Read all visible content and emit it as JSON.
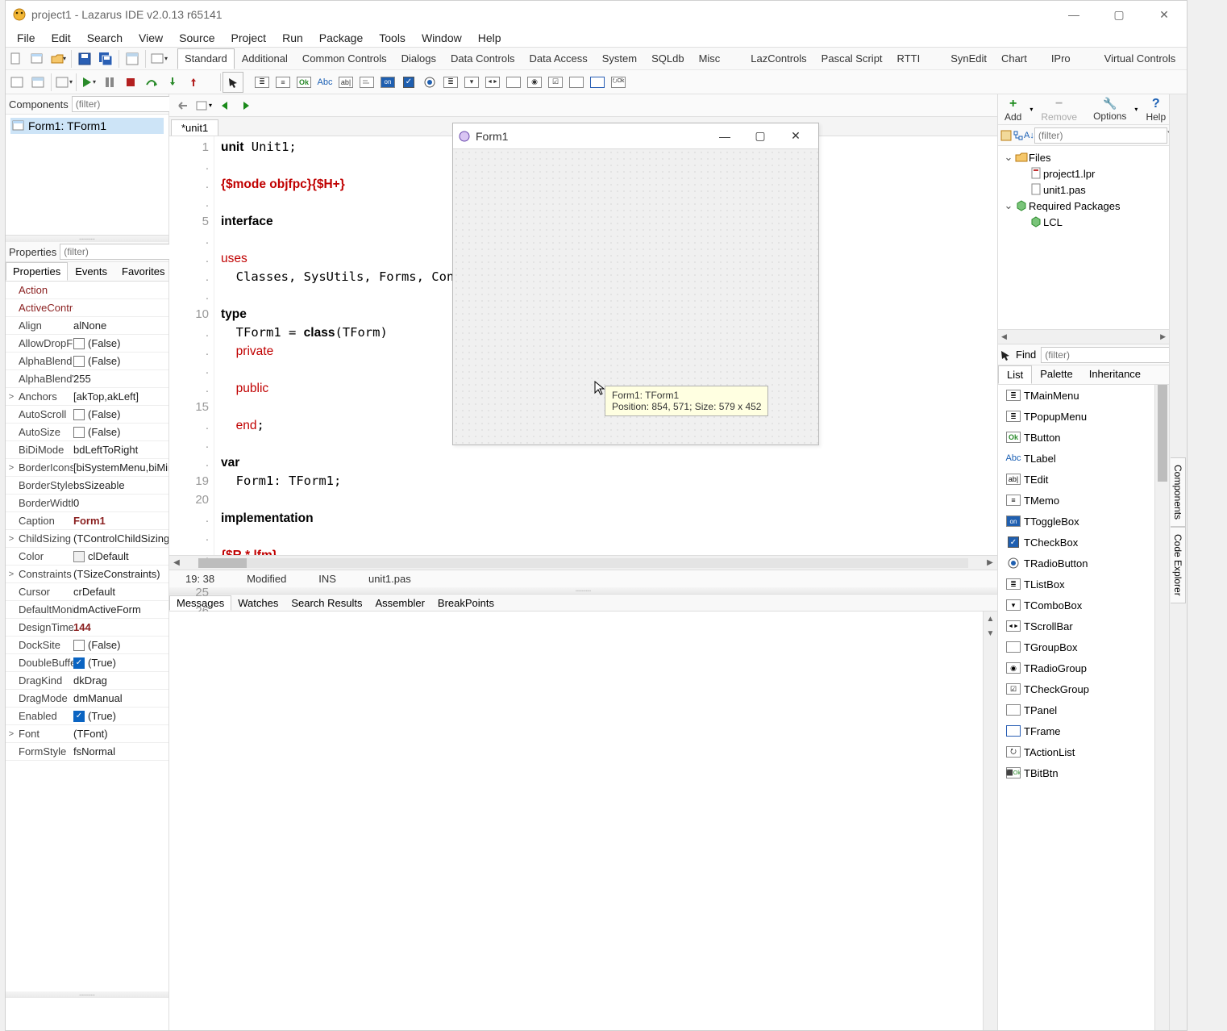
{
  "window": {
    "title": "project1 - Lazarus IDE v2.0.13 r65141"
  },
  "menu": [
    "File",
    "Edit",
    "Search",
    "View",
    "Source",
    "Project",
    "Run",
    "Package",
    "Tools",
    "Window",
    "Help"
  ],
  "palette_tabs": [
    "Standard",
    "Additional",
    "Common Controls",
    "Dialogs",
    "Data Controls",
    "Data Access",
    "System",
    "SQLdb",
    "Misc",
    "LazControls",
    "Pascal Script",
    "RTTI",
    "SynEdit",
    "Chart",
    "IPro",
    "Virtual Controls"
  ],
  "palette_tabs_active": "Standard",
  "components_panel": {
    "label": "Components",
    "filter_placeholder": "(filter)",
    "tree_item": "Form1: TForm1"
  },
  "properties_panel": {
    "label": "Properties",
    "filter_placeholder": "(filter)",
    "tabs": [
      "Properties",
      "Events",
      "Favorites"
    ],
    "active_tab": "Properties",
    "rows": [
      {
        "exp": "",
        "k": "Action",
        "v": "",
        "klink": true
      },
      {
        "exp": "",
        "k": "ActiveControl",
        "v": "",
        "klink": true
      },
      {
        "exp": "",
        "k": "Align",
        "v": "alNone"
      },
      {
        "exp": "",
        "k": "AllowDropFiles",
        "v": "(False)",
        "cb": false
      },
      {
        "exp": "",
        "k": "AlphaBlend",
        "v": "(False)",
        "cb": false
      },
      {
        "exp": "",
        "k": "AlphaBlendValue",
        "v": "255"
      },
      {
        "exp": ">",
        "k": "Anchors",
        "v": "[akTop,akLeft]"
      },
      {
        "exp": "",
        "k": "AutoScroll",
        "v": "(False)",
        "cb": false
      },
      {
        "exp": "",
        "k": "AutoSize",
        "v": "(False)",
        "cb": false
      },
      {
        "exp": "",
        "k": "BiDiMode",
        "v": "bdLeftToRight"
      },
      {
        "exp": ">",
        "k": "BorderIcons",
        "v": "[biSystemMenu,biMinimize,biMaximize]"
      },
      {
        "exp": "",
        "k": "BorderStyle",
        "v": "bsSizeable"
      },
      {
        "exp": "",
        "k": "BorderWidth",
        "v": "0"
      },
      {
        "exp": "",
        "k": "Caption",
        "v": "Form1",
        "vlink": true
      },
      {
        "exp": ">",
        "k": "ChildSizing",
        "v": "(TControlChildSizing)"
      },
      {
        "exp": "",
        "k": "Color",
        "v": "clDefault",
        "swatch": true
      },
      {
        "exp": ">",
        "k": "Constraints",
        "v": "(TSizeConstraints)"
      },
      {
        "exp": "",
        "k": "Cursor",
        "v": "crDefault"
      },
      {
        "exp": "",
        "k": "DefaultMonitor",
        "v": "dmActiveForm"
      },
      {
        "exp": "",
        "k": "DesignTimePPI",
        "v": "144",
        "vlink": true
      },
      {
        "exp": "",
        "k": "DockSite",
        "v": "(False)",
        "cb": false
      },
      {
        "exp": "",
        "k": "DoubleBuffered",
        "v": "(True)",
        "cb": true
      },
      {
        "exp": "",
        "k": "DragKind",
        "v": "dkDrag"
      },
      {
        "exp": "",
        "k": "DragMode",
        "v": "dmManual"
      },
      {
        "exp": "",
        "k": "Enabled",
        "v": "(True)",
        "cb": true
      },
      {
        "exp": ">",
        "k": "Font",
        "v": "(TFont)"
      },
      {
        "exp": "",
        "k": "FormStyle",
        "v": "fsNormal"
      }
    ]
  },
  "editor": {
    "tab": "*unit1",
    "gutter": [
      "1",
      ".",
      ".",
      ".",
      "5",
      ".",
      ".",
      ".",
      ".",
      "10",
      ".",
      ".",
      ".",
      ".",
      "15",
      ".",
      ".",
      ".",
      "19",
      "20",
      ".",
      ".",
      ".",
      ".",
      "25",
      "26"
    ],
    "status": {
      "pos": "19:  38",
      "state": "Modified",
      "mode": "INS",
      "file": "unit1.pas"
    }
  },
  "messages_tabs": [
    "Messages",
    "Watches",
    "Search Results",
    "Assembler",
    "BreakPoints"
  ],
  "right_panel": {
    "tools": {
      "add": "Add",
      "remove": "Remove",
      "options": "Options",
      "help": "Help"
    },
    "filter_placeholder": "(filter)",
    "tree": [
      {
        "exp": "v",
        "icon": "folder",
        "label": "Files",
        "indent": 0
      },
      {
        "exp": "",
        "icon": "file-lpr",
        "label": "project1.lpr",
        "indent": 1
      },
      {
        "exp": "",
        "icon": "file-pas",
        "label": "unit1.pas",
        "indent": 1
      },
      {
        "exp": "v",
        "icon": "package",
        "label": "Required Packages",
        "indent": 0
      },
      {
        "exp": "",
        "icon": "package",
        "label": "LCL",
        "indent": 1
      }
    ],
    "find_label": "Find",
    "find_placeholder": "(filter)",
    "palette_subtabs": [
      "List",
      "Palette",
      "Inheritance"
    ],
    "palette_list": [
      {
        "icon": "menu",
        "name": "TMainMenu"
      },
      {
        "icon": "menu",
        "name": "TPopupMenu"
      },
      {
        "icon": "button",
        "name": "TButton"
      },
      {
        "icon": "label",
        "name": "TLabel"
      },
      {
        "icon": "edit",
        "name": "TEdit"
      },
      {
        "icon": "memo",
        "name": "TMemo"
      },
      {
        "icon": "toggle",
        "name": "TToggleBox"
      },
      {
        "icon": "check",
        "name": "TCheckBox"
      },
      {
        "icon": "radio",
        "name": "TRadioButton"
      },
      {
        "icon": "listbox",
        "name": "TListBox"
      },
      {
        "icon": "combo",
        "name": "TComboBox"
      },
      {
        "icon": "scroll",
        "name": "TScrollBar"
      },
      {
        "icon": "group",
        "name": "TGroupBox"
      },
      {
        "icon": "rgroup",
        "name": "TRadioGroup"
      },
      {
        "icon": "cgroup",
        "name": "TCheckGroup"
      },
      {
        "icon": "panel",
        "name": "TPanel"
      },
      {
        "icon": "frame",
        "name": "TFrame"
      },
      {
        "icon": "action",
        "name": "TActionList"
      },
      {
        "icon": "bitbtn",
        "name": "TBitBtn"
      }
    ]
  },
  "side_tabs": [
    "Components",
    "Code Explorer"
  ],
  "form_designer": {
    "title": "Form1",
    "tooltip_line1": "Form1: TForm1",
    "tooltip_line2": "Position: 854, 571; Size: 579 x 452"
  }
}
